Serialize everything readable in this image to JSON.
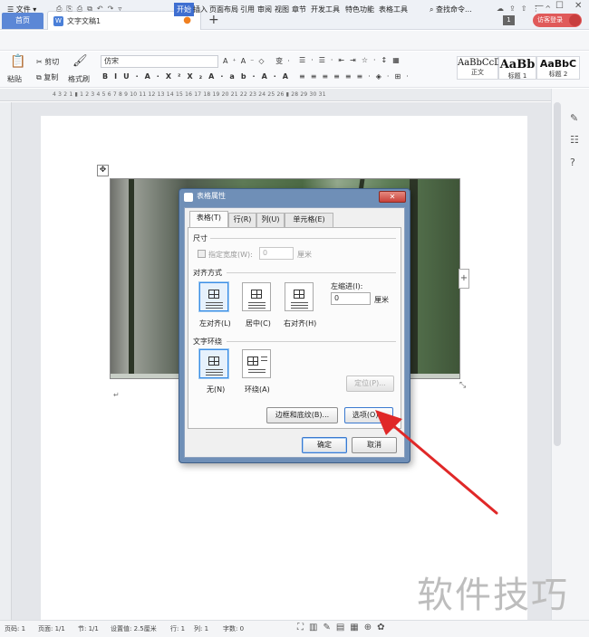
{
  "titlebar": {
    "home_tab": "首页",
    "doc_tab": "文字文稿1",
    "doc_icon": "W",
    "new_tab": "+",
    "page_badge": "1",
    "visitor_label": "访客登录",
    "min": "—",
    "max": "☐",
    "close": "✕"
  },
  "menubar": {
    "file": "☰ 文件 ▾",
    "active_tab": "开始",
    "items": [
      "插入",
      "页面布局",
      "引用",
      "审阅",
      "视图",
      "章节",
      "开发工具",
      "特色功能",
      "表格工具"
    ],
    "search": "查找命令..."
  },
  "ribbon": {
    "paste": "粘贴",
    "cut": "剪切",
    "copy": "复制",
    "format_painter": "格式刷",
    "font_name": "仿宋",
    "styles": [
      {
        "sample": "AaBbCcDd",
        "label": "正文"
      },
      {
        "sample": "AaBb",
        "label": "标题 1"
      },
      {
        "sample": "AaBbC",
        "label": "标题 2"
      }
    ]
  },
  "ruler": {
    "numbers": "4  3  2  1  ▮  1  2  3  4  5  6  7  8  9  10  11  12  13  14  15  16  17  18  19  20  21  22  23  24  25  26  ▮  28  29  30  31"
  },
  "dialog": {
    "title": "表格属性",
    "close": "✕",
    "tabs": [
      "表格(T)",
      "行(R)",
      "列(U)",
      "单元格(E)"
    ],
    "size_section": "尺寸",
    "specify_width": "指定宽度(W):",
    "width_value": "0",
    "width_unit": "厘米",
    "align_section": "对齐方式",
    "align_left": "左对齐(L)",
    "align_center": "居中(C)",
    "align_right": "右对齐(H)",
    "left_indent": "左缩进(I):",
    "indent_value": "0",
    "indent_unit": "厘米",
    "wrap_section": "文字环绕",
    "wrap_none": "无(N)",
    "wrap_around": "环绕(A)",
    "position_button": "定位(P)...",
    "borders_button": "边框和底纹(B)...",
    "options_button": "选项(O)...",
    "ok_button": "确定",
    "cancel_button": "取消"
  },
  "status": {
    "page": "页码: 1",
    "pages": "页面: 1/1",
    "section": "节: 1/1",
    "setting": "设置值: 2.5厘米",
    "row": "行: 1",
    "col": "列: 1",
    "words": "字数: 0"
  },
  "watermark": "软件技巧",
  "colors": {
    "accent": "#3f6fd1",
    "arrow": "#e02828",
    "visitor": "#e05a5a"
  }
}
